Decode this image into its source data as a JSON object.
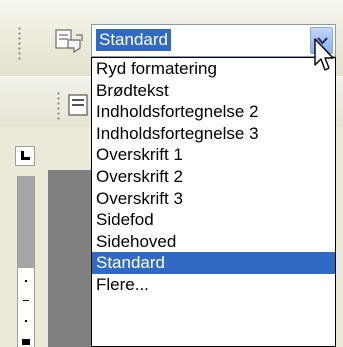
{
  "style_selector": {
    "current_value": "Standard",
    "icon": "styles-icon",
    "dropdown_arrow_icon": "chevron-down-icon",
    "options": [
      "Ryd formatering",
      "Brødtekst",
      "Indholdsfortegnelse 2",
      "Indholdsfortegnelse 3",
      "Overskrift 1",
      "Overskrift 2",
      "Overskrift 3",
      "Sidefod",
      "Sidehoved",
      "Standard",
      "Flere..."
    ],
    "selected_option": "Standard"
  },
  "colors": {
    "selection_blue": "#316ac5",
    "toolbar_bg": "#ece9d8",
    "combo_border": "#7f9db9"
  },
  "cursor": {
    "icon": "mouse-pointer-icon"
  }
}
